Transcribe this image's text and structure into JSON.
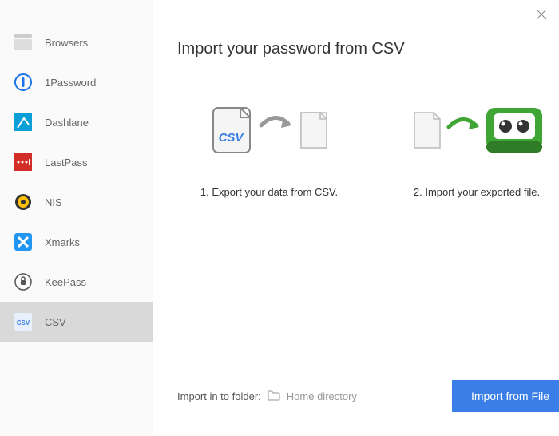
{
  "sidebar": {
    "items": [
      {
        "label": "Browsers",
        "active": false
      },
      {
        "label": "1Password",
        "active": false
      },
      {
        "label": "Dashlane",
        "active": false
      },
      {
        "label": "LastPass",
        "active": false
      },
      {
        "label": "NIS",
        "active": false
      },
      {
        "label": "Xmarks",
        "active": false
      },
      {
        "label": "KeePass",
        "active": false
      },
      {
        "label": "CSV",
        "active": true
      }
    ]
  },
  "main": {
    "title": "Import your password from CSV",
    "step1_label": "1. Export your data from CSV.",
    "step2_label": "2. Import your exported file.",
    "csv_badge": "CSV"
  },
  "footer": {
    "folder_label": "Import in to folder:",
    "folder_path": "Home directory",
    "import_button": "Import from File"
  }
}
